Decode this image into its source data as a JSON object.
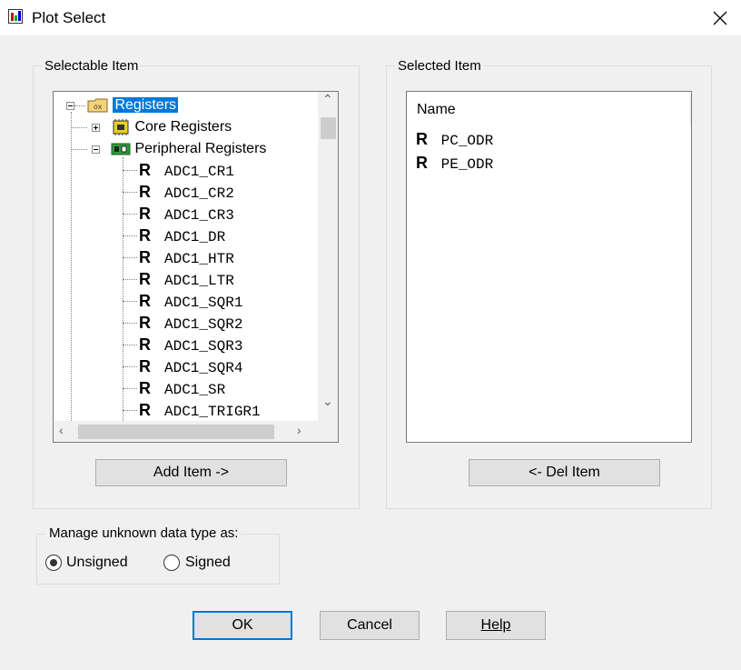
{
  "window": {
    "title": "Plot Select"
  },
  "selectable_group": {
    "label": "Selectable Item"
  },
  "selected_group": {
    "label": "Selected Item"
  },
  "tree": {
    "root": {
      "label": "Registers",
      "expanded": true
    },
    "children": [
      {
        "label": "Core Registers",
        "expanded": false
      },
      {
        "label": "Peripheral Registers",
        "expanded": true
      }
    ],
    "register_icon": "R",
    "registers": [
      "ADC1_CR1",
      "ADC1_CR2",
      "ADC1_CR3",
      "ADC1_DR",
      "ADC1_HTR",
      "ADC1_LTR",
      "ADC1_SQR1",
      "ADC1_SQR2",
      "ADC1_SQR3",
      "ADC1_SQR4",
      "ADC1_SR",
      "ADC1_TRIGR1"
    ]
  },
  "selected_list": {
    "column_name": "Name",
    "items": [
      "PC_ODR",
      "PE_ODR"
    ]
  },
  "buttons": {
    "add": "Add Item ->",
    "del": "<- Del Item",
    "ok": "OK",
    "cancel": "Cancel",
    "help": "Help"
  },
  "data_type_group": {
    "label": "Manage unknown data type as:",
    "options": [
      "Unsigned",
      "Signed"
    ],
    "selected": "Unsigned"
  },
  "colors": {
    "selection": "#0078d7",
    "default_button_border": "#0078d7"
  }
}
